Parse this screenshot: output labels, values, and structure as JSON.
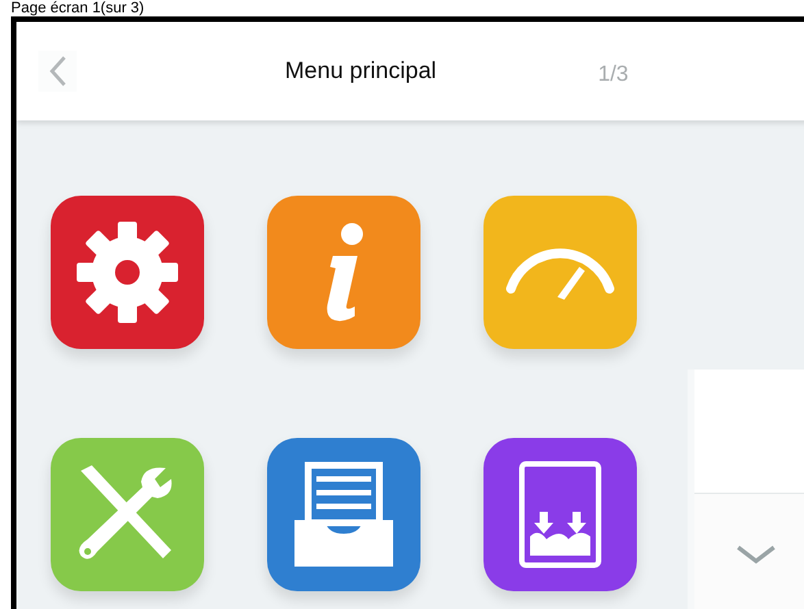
{
  "caption": "Page écran 1(sur 3)",
  "header": {
    "title": "Menu principal",
    "page": "1/3"
  },
  "tiles": [
    {
      "kind": "gear",
      "color": "#d9222f"
    },
    {
      "kind": "info",
      "color": "#f28a1c"
    },
    {
      "kind": "gauge",
      "color": "#f2b61c"
    },
    {
      "kind": "tools",
      "color": "#86c94a"
    },
    {
      "kind": "tray",
      "color": "#2f7fd0"
    },
    {
      "kind": "download",
      "color": "#8a3ce8"
    }
  ]
}
